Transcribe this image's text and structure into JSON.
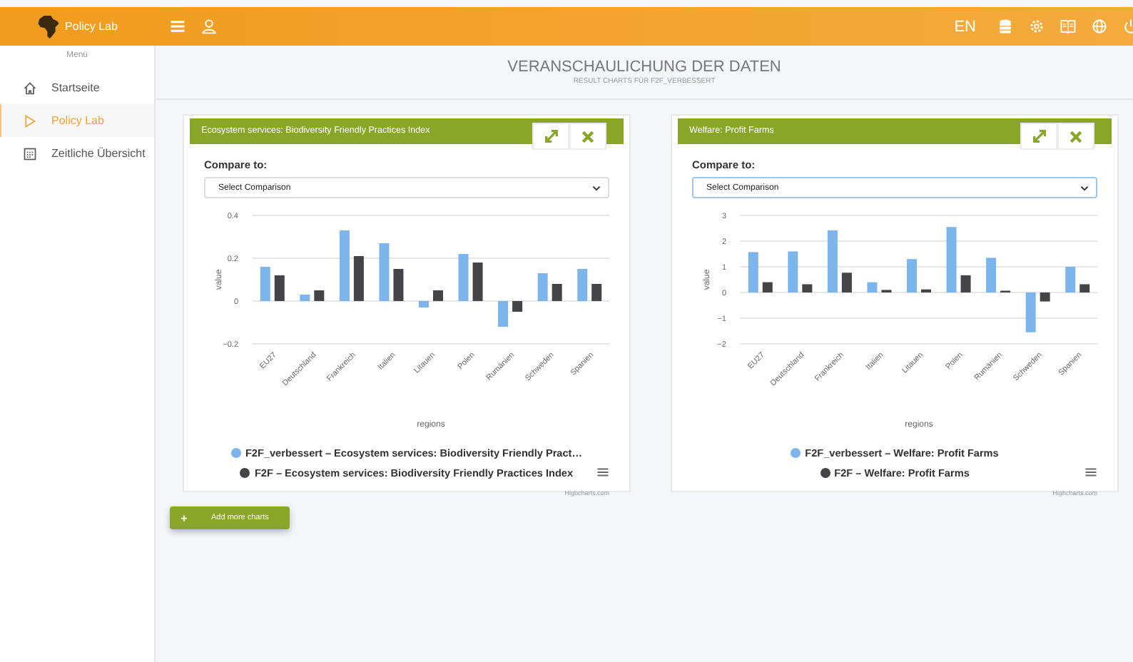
{
  "header": {
    "app_name": "Policy Lab",
    "language": "EN"
  },
  "sidebar": {
    "heading": "Menü",
    "items": [
      {
        "label": "Startseite",
        "selected": false
      },
      {
        "label": "Policy Lab",
        "selected": true
      },
      {
        "label": "Zeitliche Übersicht",
        "selected": false
      }
    ]
  },
  "page": {
    "title": "VERANSCHAULICHUNG DER DATEN",
    "subtitle": "RESULT CHARTS FÜR F2F_VERBESSERT"
  },
  "charts": [
    {
      "title": "Ecosystem services: Biodiversity Friendly Practices Index",
      "compare_label": "Compare to:",
      "select_value": "Select Comparison",
      "focused": false,
      "credit": "Highcharts.com",
      "chart_data": {
        "type": "bar",
        "legend": "bottom",
        "grid": true,
        "xlabel": "regions",
        "ylabel": "value",
        "categories": [
          "EU27",
          "Deutschland",
          "Frankreich",
          "Italien",
          "Litauen",
          "Polen",
          "Rumänien",
          "Schweden",
          "Spanien"
        ],
        "ylim": [
          -0.2,
          0.4
        ],
        "yticks": [
          -0.2,
          0,
          0.2,
          0.4
        ],
        "series": [
          {
            "name": "F2F_verbessert – Ecosystem services: Biodiversity Friendly Pract…",
            "color": "#7cb5ec",
            "values": [
              0.16,
              0.03,
              0.33,
              0.27,
              -0.03,
              0.22,
              -0.12,
              0.13,
              0.15
            ]
          },
          {
            "name": "F2F – Ecosystem services: Biodiversity Friendly Practices Index",
            "color": "#434348",
            "values": [
              0.12,
              0.05,
              0.21,
              0.15,
              0.05,
              0.18,
              -0.05,
              0.08,
              0.08
            ]
          }
        ]
      }
    },
    {
      "title": "Welfare: Profit Farms",
      "compare_label": "Compare to:",
      "select_value": "Select Comparison",
      "focused": true,
      "credit": "Highcharts.com",
      "chart_data": {
        "type": "bar",
        "legend": "bottom",
        "grid": true,
        "xlabel": "regions",
        "ylabel": "value",
        "categories": [
          "EU27",
          "Deutschland",
          "Frankreich",
          "Italien",
          "Litauen",
          "Polen",
          "Rumänien",
          "Schweden",
          "Spanien"
        ],
        "ylim": [
          -2,
          3
        ],
        "yticks": [
          -2,
          -1,
          0,
          1,
          2,
          3
        ],
        "series": [
          {
            "name": "F2F_verbessert – Welfare: Profit Farms",
            "color": "#7cb5ec",
            "values": [
              1.57,
              1.6,
              2.42,
              0.4,
              1.3,
              2.55,
              1.35,
              -1.55,
              1.0
            ]
          },
          {
            "name": "F2F – Welfare: Profit Farms",
            "color": "#434348",
            "values": [
              0.4,
              0.32,
              0.77,
              0.1,
              0.12,
              0.67,
              0.07,
              -0.35,
              0.32
            ]
          }
        ]
      }
    }
  ],
  "add_button": {
    "icon": "+",
    "label": "Add more charts"
  }
}
